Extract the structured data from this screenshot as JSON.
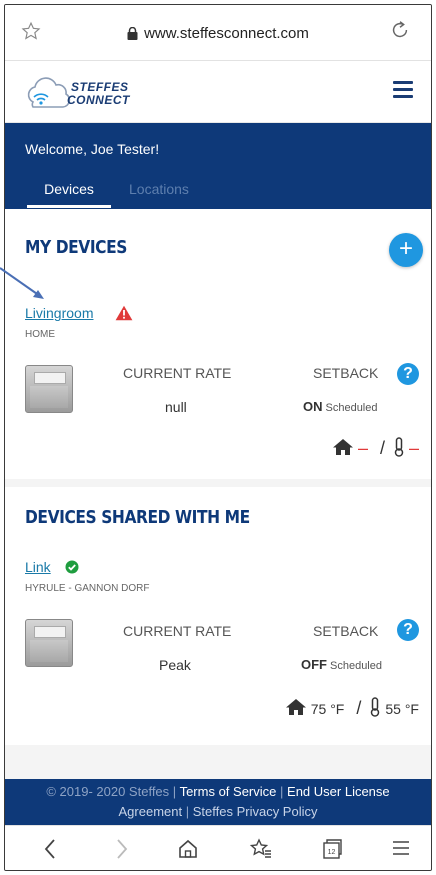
{
  "browser": {
    "url": "www.steffesconnect.com"
  },
  "logo": {
    "line1": "STEFFES",
    "line2": "CONNECT"
  },
  "welcome": {
    "text": "Welcome, Joe Tester!"
  },
  "tabs": [
    {
      "label": "Devices",
      "active": true
    },
    {
      "label": "Locations",
      "active": false
    }
  ],
  "my_devices": {
    "title": "MY DEVICES",
    "add_button": "+",
    "device": {
      "name": "Livingroom",
      "location": "HOME",
      "status_icon": "warning-triangle",
      "current_rate_label": "CURRENT RATE",
      "current_rate_value": "null",
      "setback_label": "SETBACK",
      "setback_state": "ON",
      "setback_mode": "Scheduled",
      "indoor_temp": "–",
      "sep": "/",
      "outdoor_temp": "–"
    }
  },
  "shared_devices": {
    "title": "DEVICES SHARED WITH ME",
    "device": {
      "name": "Link",
      "location": "HYRULE - GANNON DORF",
      "status_icon": "check-circle",
      "current_rate_label": "CURRENT RATE",
      "current_rate_value": "Peak",
      "setback_label": "SETBACK",
      "setback_state": "OFF",
      "setback_mode": "Scheduled",
      "indoor_temp": "75 °F",
      "sep": "/",
      "outdoor_temp": "55 °F"
    }
  },
  "footer": {
    "copyright": "© 2019- 2020 Steffes",
    "divider": "|",
    "terms": "Terms of Service",
    "eula_part1": "End User License",
    "eula_part2": "Agreement",
    "privacy": "Steffes Privacy Policy"
  },
  "colors": {
    "navy": "#0e3979",
    "accent_blue": "#1f97e0",
    "warning_red": "#e03a3a",
    "success_green": "#1f9d3f"
  }
}
